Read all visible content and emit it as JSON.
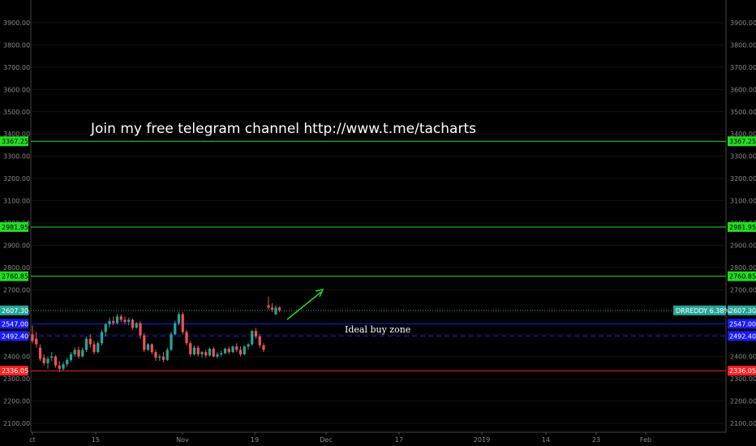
{
  "chart_data": {
    "type": "candlestick",
    "yticks": [
      "2100.00",
      "2200.00",
      "2300.00",
      "2400.00",
      "2500.00",
      "2600.00",
      "2700.00",
      "2800.00",
      "2900.00",
      "3000.00",
      "3100.00",
      "3200.00",
      "3300.00",
      "3400.00",
      "3500.00",
      "3600.00",
      "3700.00",
      "3800.00",
      "3900.00"
    ],
    "ylim": [
      2080,
      3940
    ],
    "xticks": [
      "ct",
      "15",
      "Nov",
      "19",
      "Dec",
      "17",
      "2019",
      "14",
      "23",
      "Feb"
    ],
    "candles": [
      [
        2500,
        2540,
        2460,
        2470
      ],
      [
        2480,
        2510,
        2440,
        2455
      ],
      [
        2440,
        2455,
        2380,
        2390
      ],
      [
        2395,
        2410,
        2360,
        2370
      ],
      [
        2370,
        2400,
        2345,
        2390
      ],
      [
        2395,
        2420,
        2380,
        2400
      ],
      [
        2400,
        2405,
        2350,
        2360
      ],
      [
        2360,
        2380,
        2330,
        2345
      ],
      [
        2345,
        2375,
        2335,
        2365
      ],
      [
        2365,
        2395,
        2355,
        2385
      ],
      [
        2385,
        2420,
        2375,
        2410
      ],
      [
        2410,
        2440,
        2400,
        2430
      ],
      [
        2430,
        2445,
        2390,
        2400
      ],
      [
        2400,
        2440,
        2395,
        2430
      ],
      [
        2430,
        2490,
        2420,
        2480
      ],
      [
        2480,
        2500,
        2440,
        2455
      ],
      [
        2455,
        2470,
        2410,
        2420
      ],
      [
        2420,
        2470,
        2415,
        2460
      ],
      [
        2460,
        2520,
        2450,
        2510
      ],
      [
        2510,
        2550,
        2490,
        2545
      ],
      [
        2545,
        2575,
        2530,
        2560
      ],
      [
        2560,
        2580,
        2540,
        2550
      ],
      [
        2550,
        2590,
        2545,
        2580
      ],
      [
        2580,
        2590,
        2555,
        2565
      ],
      [
        2565,
        2580,
        2545,
        2555
      ],
      [
        2555,
        2575,
        2540,
        2565
      ],
      [
        2565,
        2570,
        2520,
        2530
      ],
      [
        2530,
        2555,
        2525,
        2550
      ],
      [
        2550,
        2560,
        2480,
        2495
      ],
      [
        2495,
        2505,
        2420,
        2430
      ],
      [
        2430,
        2460,
        2425,
        2455
      ],
      [
        2455,
        2460,
        2410,
        2420
      ],
      [
        2420,
        2430,
        2380,
        2395
      ],
      [
        2395,
        2410,
        2380,
        2400
      ],
      [
        2400,
        2420,
        2375,
        2385
      ],
      [
        2385,
        2440,
        2380,
        2430
      ],
      [
        2430,
        2510,
        2425,
        2500
      ],
      [
        2500,
        2560,
        2495,
        2550
      ],
      [
        2550,
        2600,
        2540,
        2590
      ],
      [
        2590,
        2600,
        2500,
        2510
      ],
      [
        2510,
        2520,
        2450,
        2460
      ],
      [
        2460,
        2470,
        2400,
        2410
      ],
      [
        2410,
        2450,
        2405,
        2440
      ],
      [
        2440,
        2450,
        2400,
        2410
      ],
      [
        2410,
        2425,
        2395,
        2420
      ],
      [
        2420,
        2430,
        2395,
        2405
      ],
      [
        2405,
        2440,
        2400,
        2435
      ],
      [
        2435,
        2445,
        2395,
        2400
      ],
      [
        2400,
        2420,
        2390,
        2410
      ],
      [
        2410,
        2425,
        2400,
        2415
      ],
      [
        2415,
        2440,
        2410,
        2435
      ],
      [
        2435,
        2445,
        2410,
        2420
      ],
      [
        2420,
        2450,
        2415,
        2445
      ],
      [
        2445,
        2460,
        2420,
        2430
      ],
      [
        2430,
        2445,
        2400,
        2410
      ],
      [
        2410,
        2450,
        2405,
        2445
      ],
      [
        2445,
        2460,
        2430,
        2455
      ],
      [
        2455,
        2520,
        2450,
        2515
      ],
      [
        2515,
        2530,
        2480,
        2490
      ],
      [
        2490,
        2500,
        2440,
        2450
      ],
      [
        2450,
        2460,
        2420,
        2430
      ],
      [
        2630,
        2670,
        2610,
        2620
      ],
      [
        2620,
        2640,
        2600,
        2610
      ],
      [
        2590,
        2630,
        2585,
        2620
      ],
      [
        2620,
        2625,
        2600,
        2607
      ]
    ],
    "lines": [
      {
        "value": 3367.25,
        "label": "3367.25",
        "color": "#22dd22",
        "style": "solid"
      },
      {
        "value": 2981.95,
        "label": "2981.95",
        "color": "#22dd22",
        "style": "solid"
      },
      {
        "value": 2760.85,
        "label": "2760.85",
        "color": "#22dd22",
        "style": "solid"
      },
      {
        "value": 2607.3,
        "label": "2607.30",
        "color": "#26a69a",
        "style": "dotted"
      },
      {
        "value": 2547.0,
        "label": "2547.00",
        "color": "#1a1aff",
        "style": "solid"
      },
      {
        "value": 2492.4,
        "label": "2492.40",
        "color": "#1a1aff",
        "style": "dashed"
      },
      {
        "value": 2336.05,
        "label": "2336.05",
        "color": "#ff2222",
        "style": "solid"
      }
    ],
    "symbol_label": "DRREDDY 6.38%",
    "colors": {
      "up": "#26a69a",
      "down": "#ef5350",
      "grid": "#1a1a1a",
      "axis": "#555555",
      "arrow": "#22dd22"
    }
  },
  "annotations": {
    "telegram": "Join my free telegram channel http://www.t.me/tacharts",
    "buy_zone": "Ideal buy zone"
  }
}
